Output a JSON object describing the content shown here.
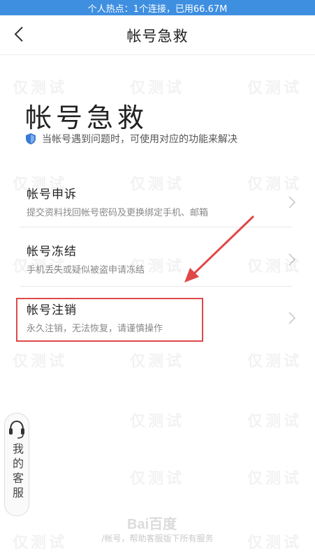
{
  "status_bar": {
    "text": "个人热点：1个连接，已用66.67M"
  },
  "nav": {
    "title": "帐号急救",
    "back_icon": "chevron-left-icon"
  },
  "header": {
    "title": "帐号急救",
    "hint": "当帐号遇到问题时，可使用对应的功能来解决",
    "hint_icon": "shield-icon"
  },
  "items": [
    {
      "title": "帐号申诉",
      "desc": "提交资料找回帐号密码及更换绑定手机、邮箱"
    },
    {
      "title": "帐号冻结",
      "desc": "手机丢失或疑似被盗申请冻结"
    },
    {
      "title": "帐号注销",
      "desc": "永久注销，无法恢复，请谨慎操作"
    }
  ],
  "customer_service": {
    "label": "我的客服",
    "icon": "headset-icon"
  },
  "watermark": {
    "text": "仅测试"
  },
  "baidu_mark": {
    "text": "Bai百度"
  },
  "footer": {
    "text": "/帐号，帮助客服版下所有服务"
  },
  "colors": {
    "status_bar": "#3f8fe0",
    "highlight": "#e04848",
    "accent": "#3a7bd5"
  }
}
